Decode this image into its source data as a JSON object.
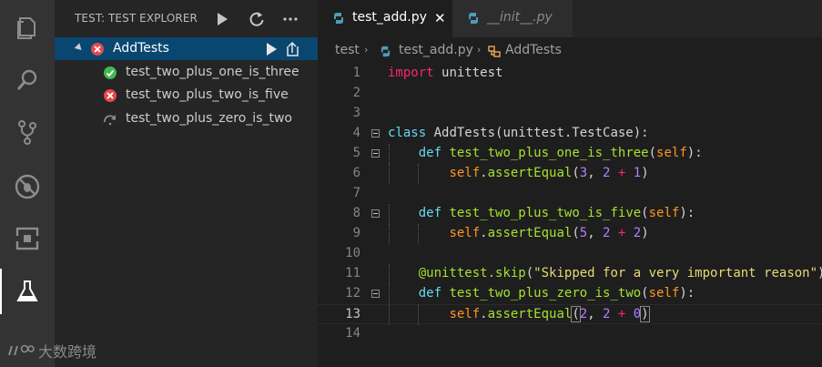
{
  "sidebar": {
    "title": "TEST: TEST EXPLORER",
    "items": [
      {
        "label": "AddTests",
        "status": "failed"
      },
      {
        "label": "test_two_plus_one_is_three",
        "status": "passed"
      },
      {
        "label": "test_two_plus_two_is_five",
        "status": "failed"
      },
      {
        "label": "test_two_plus_zero_is_two",
        "status": "skipped"
      }
    ]
  },
  "tabs": [
    {
      "label": "test_add.py",
      "active": true
    },
    {
      "label": "__init__.py",
      "active": false
    }
  ],
  "breadcrumb": [
    "test",
    "test_add.py",
    "AddTests"
  ],
  "code": {
    "lines": [
      {
        "n": "1",
        "t": "import unittest"
      },
      {
        "n": "2",
        "t": ""
      },
      {
        "n": "3",
        "t": ""
      },
      {
        "n": "4",
        "t": "class AddTests(unittest.TestCase):"
      },
      {
        "n": "5",
        "t": "    def test_two_plus_one_is_three(self):"
      },
      {
        "n": "6",
        "t": "        self.assertEqual(3, 2 + 1)"
      },
      {
        "n": "7",
        "t": ""
      },
      {
        "n": "8",
        "t": "    def test_two_plus_two_is_five(self):"
      },
      {
        "n": "9",
        "t": "        self.assertEqual(5, 2 + 2)"
      },
      {
        "n": "10",
        "t": ""
      },
      {
        "n": "11",
        "t": "    @unittest.skip(\"Skipped for a very important reason\")"
      },
      {
        "n": "12",
        "t": "    def test_two_plus_zero_is_two(self):"
      },
      {
        "n": "13",
        "t": "        self.assertEqual(2, 2 + 0)"
      },
      {
        "n": "14",
        "t": ""
      }
    ]
  },
  "watermark": "大数跨境",
  "colors": {
    "pass": "#3fb950",
    "fail": "#e5484d",
    "selection": "#094771",
    "python_blue": "#519aba"
  },
  "icons": [
    "explorer-icon",
    "search-icon",
    "source-control-icon",
    "debug-icon",
    "extensions-icon",
    "test-beaker-icon",
    "run-icon",
    "refresh-icon",
    "more-icon",
    "open-file-icon",
    "python-file-icon",
    "class-icon"
  ]
}
